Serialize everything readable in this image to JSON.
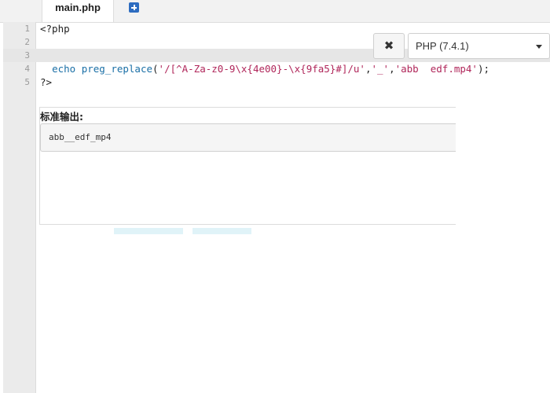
{
  "tabs": {
    "active_file": "main.php"
  },
  "editor": {
    "line_numbers": [
      "1",
      "2",
      "3",
      "4",
      "5"
    ],
    "code": {
      "line1": "<?php",
      "line4": {
        "keyword_echo": "echo",
        "function_name": "preg_replace",
        "open_paren": "(",
        "pattern": "'/[^A-Za-z0-9\\x{4e00}-\\x{9fa5}#]/u'",
        "comma1": ",",
        "replacement": "'_'",
        "comma2": ",",
        "subject": "'abb  edf.mp4'",
        "close": ");"
      },
      "line5": "?>"
    }
  },
  "toolbar": {
    "close_icon_glyph": "✖",
    "php_version": "PHP (7.4.1)"
  },
  "output": {
    "label": "标准输出:",
    "value": "abb__edf_mp4"
  },
  "colors": {
    "keyword": "#1a6fa6",
    "string": "#b0265a",
    "add_tab_icon": "#2d6cc0"
  }
}
